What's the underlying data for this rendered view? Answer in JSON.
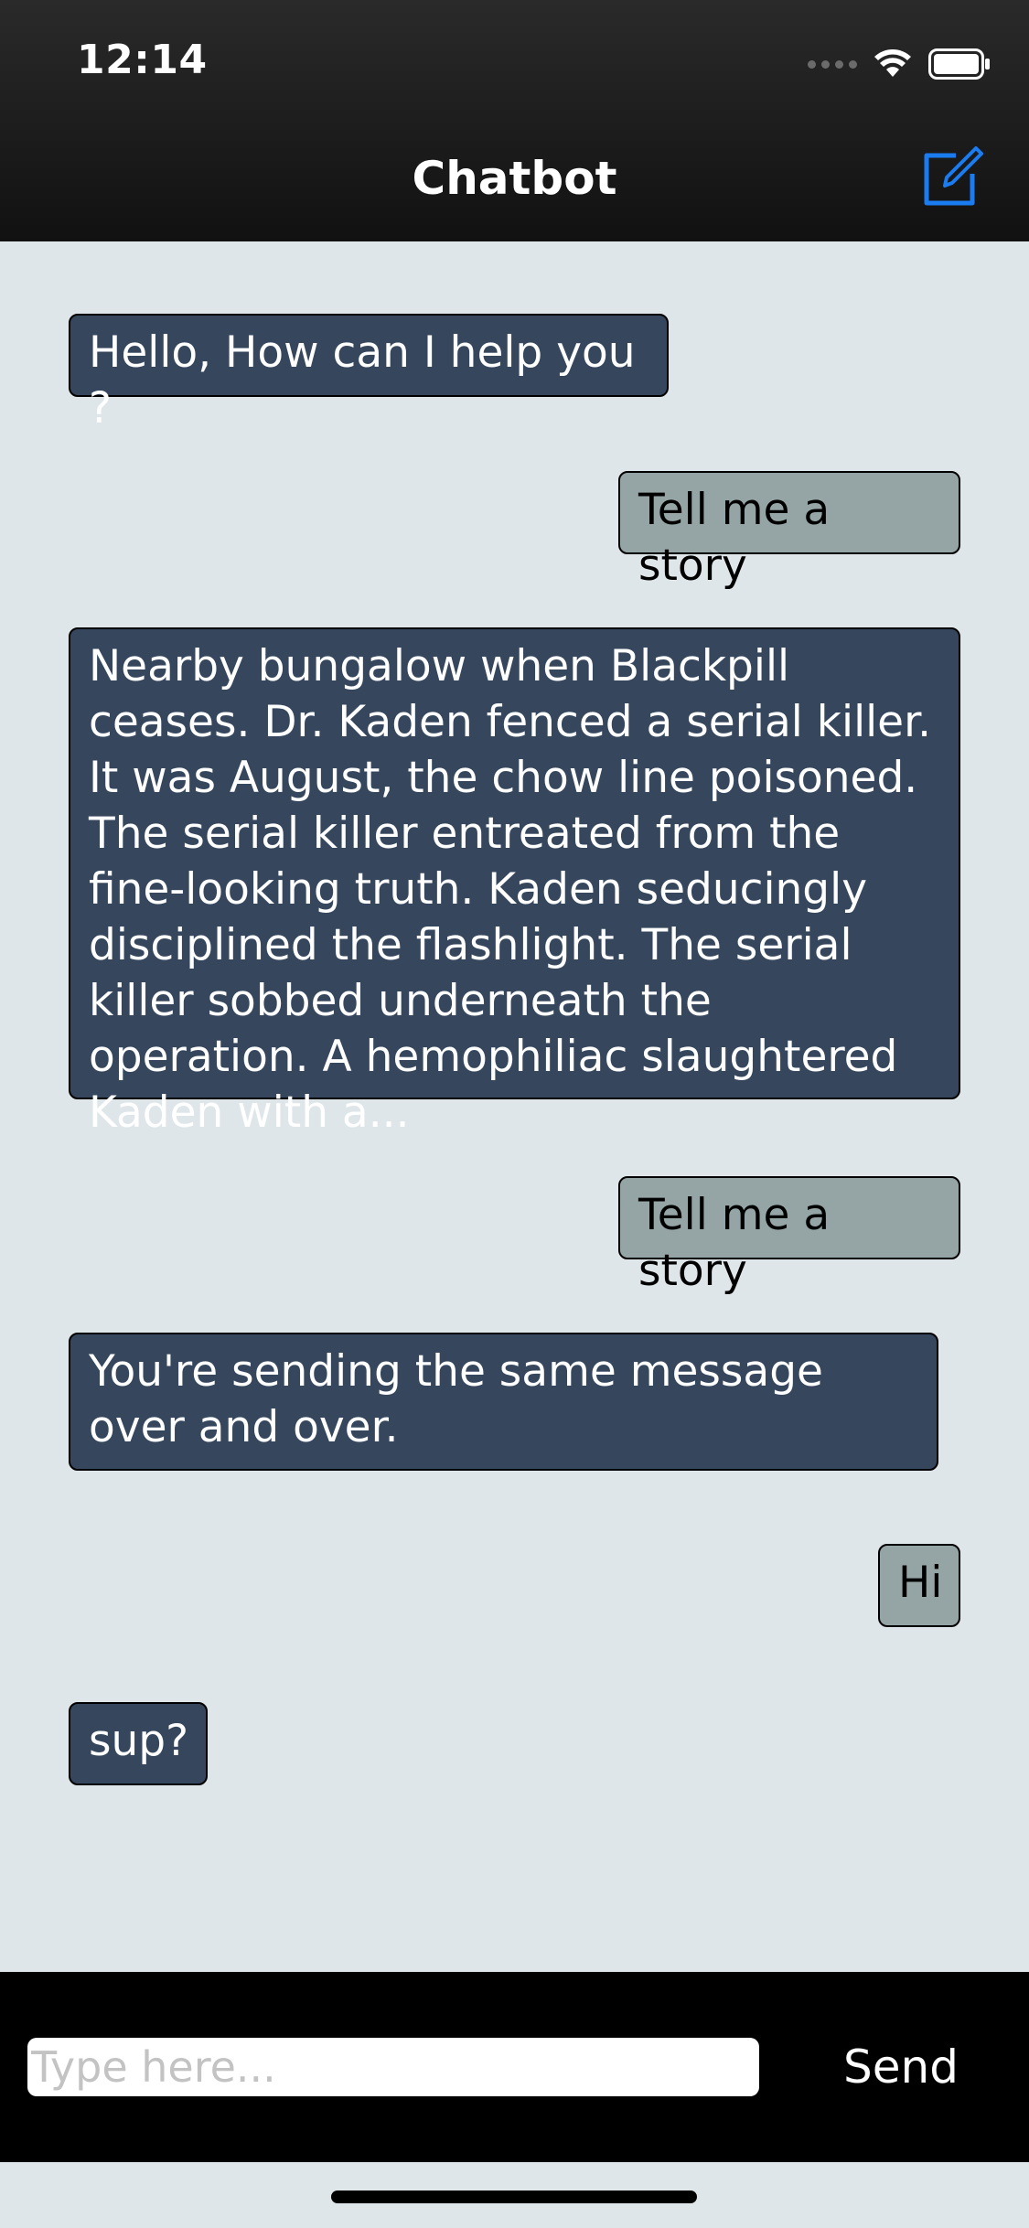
{
  "status_bar": {
    "time": "12:14"
  },
  "nav": {
    "title": "Chatbot",
    "compose_icon": "compose-icon",
    "accent_color": "#1a7cf0"
  },
  "messages": [
    {
      "sender": "bot",
      "text": "Hello, How can I help you ?"
    },
    {
      "sender": "user",
      "text": "Tell me a story"
    },
    {
      "sender": "bot",
      "text": "Nearby bungalow when Blackpill ceases. Dr. Kaden fenced a serial killer. It was August, the chow line poisoned. The serial killer entreated from the fine-looking truth. Kaden seducingly disciplined the flashlight. The serial killer sobbed underneath the operation. A hemophiliac slaughtered Kaden with a..."
    },
    {
      "sender": "user",
      "text": "Tell me a story"
    },
    {
      "sender": "bot",
      "text": "You're sending the same message over and over."
    },
    {
      "sender": "user",
      "text": "Hi"
    },
    {
      "sender": "bot",
      "text": "sup?"
    }
  ],
  "input_bar": {
    "value": "",
    "placeholder": "Type here...",
    "send_label": "Send"
  },
  "colors": {
    "bot_bubble": "#36475d",
    "user_bubble": "#95a5a6",
    "chat_background": "#dfe6ea"
  }
}
